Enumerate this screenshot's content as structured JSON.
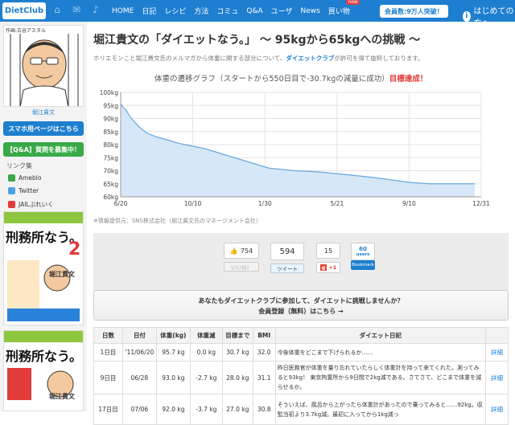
{
  "header": {
    "logo": "DietClub",
    "nav": [
      "HOME",
      "日記",
      "レシピ",
      "方法",
      "コミュ",
      "Q&A",
      "ユーザ",
      "News",
      "買い物"
    ],
    "new_badge": "new",
    "members": "会員数:9万人突破！",
    "guide": "はじめての方へ"
  },
  "sidebar": {
    "portrait_caption": "作画:古谷アスタル",
    "name": "堀江貴文",
    "smartphone_btn": "スマホ用ページはこちら",
    "qa_btn": "【Q&A】質問を募集中！",
    "links_head": "リンク集",
    "links": [
      "Ameblo",
      "Twitter",
      "JAILぶれいく"
    ],
    "book1_title": "刑務所なう。",
    "book1_num": "2",
    "book1_author": "堀江貴文",
    "book2_title": "刑務所なう。",
    "book2_author": "堀江貴文"
  },
  "main": {
    "title": "堀江貴文の「ダイエットなう。」 〜 95kgから65kgへの挑戦 〜",
    "subtitle_pre": "ホリエモンこと堀江貴文氏のメルマガから体重に関する部分について、",
    "subtitle_link": "ダイエットクラブ",
    "subtitle_post": "が許可を得て抜粋しております。",
    "chart_title": "体重の遷移グラフ（スタートから550日目で-30.7kgの減量に成功）",
    "chart_title_red": "目標達成！",
    "credit": "※情報提供元：SNS株式会社（堀江貴文氏のマネージメント会社）"
  },
  "chart_data": {
    "type": "area",
    "ylabel_ticks": [
      "60kg",
      "65kg",
      "70kg",
      "75kg",
      "80kg",
      "85kg",
      "90kg",
      "95kg",
      "100kg"
    ],
    "xlabel_ticks": [
      "6/20",
      "10/10",
      "1/30",
      "5/21",
      "9/10",
      "12/31"
    ],
    "ylim": [
      60,
      100
    ],
    "x_day": [
      0,
      3,
      9,
      15,
      22,
      30,
      40,
      55,
      70,
      90,
      110,
      130,
      150,
      170,
      190,
      210,
      230,
      250,
      270,
      290,
      310,
      330,
      350,
      370,
      390,
      420,
      450,
      480,
      510,
      550
    ],
    "y_kg": [
      95.7,
      94.5,
      93.0,
      90.5,
      88.5,
      86.5,
      84.5,
      83.0,
      82.0,
      80.5,
      79.5,
      78.5,
      77.0,
      75.5,
      74.0,
      72.5,
      71.0,
      70.5,
      70.0,
      69.8,
      69.5,
      69.0,
      68.5,
      68.0,
      67.5,
      66.5,
      65.5,
      65.0,
      65.0,
      65.0
    ],
    "fill": "#d6e8f7",
    "line": "#6aa7dc",
    "grid": true
  },
  "social": {
    "fb_count": "754",
    "fb_like": "いいね！",
    "tw_count": "594",
    "tw_btn": "ツイート",
    "gp_count": "15",
    "gp_btn": "+1",
    "hb_count": "60",
    "hb_unit": "users",
    "hb_btn": "Bookmark"
  },
  "cta": {
    "line1": "あなたもダイエットクラブに参加して、ダイエットに挑戦しませんか？",
    "line2": "会員登録（無料）はこちら →"
  },
  "table": {
    "headers": [
      "日数",
      "日付",
      "体重(kg)",
      "体重減",
      "目標まで",
      "BMI",
      "ダイエット日記",
      ""
    ],
    "rows": [
      [
        "1日目",
        "'11/06/20",
        "95.7 kg",
        "0.0 kg",
        "30.7 kg",
        "32.0",
        "今後体重をどこまで下げられるか……",
        "詳細"
      ],
      [
        "9日目",
        "06/28",
        "93.0 kg",
        "-2.7 kg",
        "28.0 kg",
        "31.1",
        "昨日医務官が体重を量り忘れていたらしく体重計を持って来てくれた。測ってみると93kg！ 東京拘置所から9日間で2kg減である。さてさて、どこまで体重を減らせるか。",
        "詳細"
      ],
      [
        "17日目",
        "07/06",
        "92.0 kg",
        "-3.7 kg",
        "27.0 kg",
        "30.8",
        "そういえば、風呂から上がったら体重計があったので乗ってみると……92kg。収監当初より3.7kg減。最初に入ってから1kg減っ",
        "詳細"
      ]
    ]
  }
}
